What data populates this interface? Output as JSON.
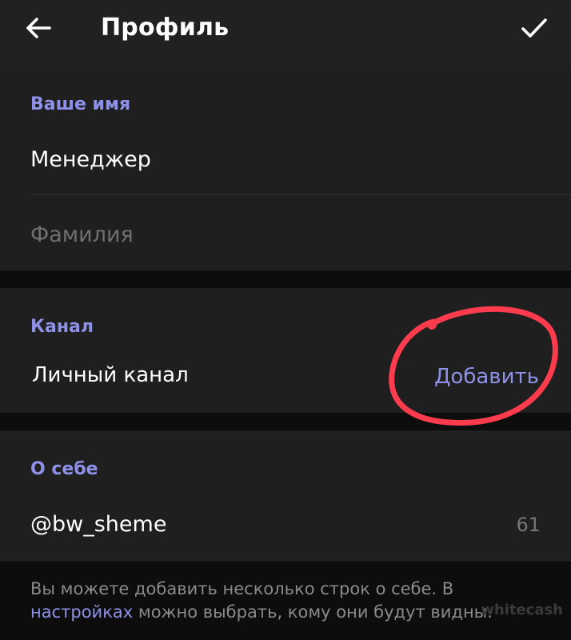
{
  "header": {
    "title": "Профиль",
    "back_icon": "arrow-left-icon",
    "confirm_icon": "check-icon"
  },
  "name_section": {
    "header": "Ваше имя",
    "first_name_value": "Менеджер",
    "last_name_placeholder": "Фамилия"
  },
  "channel_section": {
    "header": "Канал",
    "label": "Личный канал",
    "add_label": "Добавить"
  },
  "about_section": {
    "header": "О себе",
    "value": "@bw_sheme",
    "counter": "61"
  },
  "hint": {
    "text_before": "Вы можете добавить несколько строк о себе. В ",
    "link": "настройках",
    "text_after": " можно выбрать, кому они будут видны."
  },
  "watermark": "whitecash",
  "colors": {
    "accent": "#8e91e8",
    "background": "#0d0d0d",
    "surface": "#1f1f1f",
    "annotation": "#ff3b4e"
  }
}
